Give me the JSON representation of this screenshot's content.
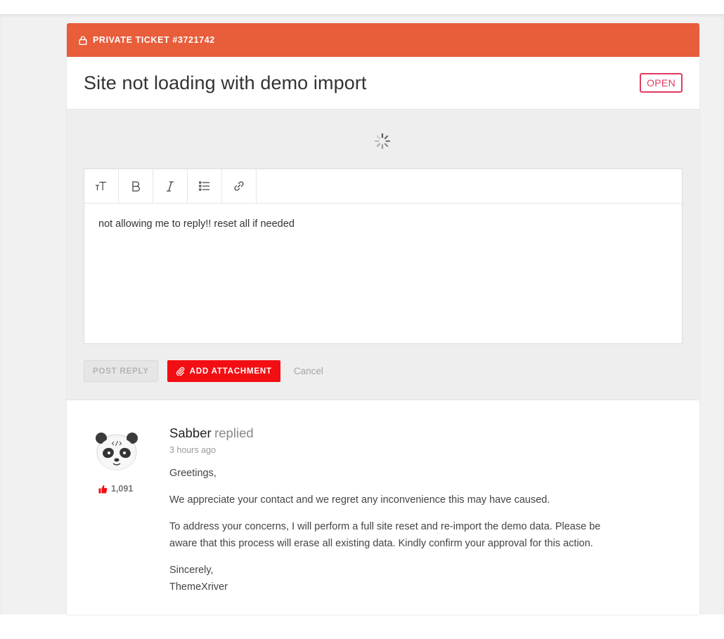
{
  "ticket": {
    "header_label": "PRIVATE TICKET #3721742",
    "title": "Site not loading with demo import",
    "status": "OPEN",
    "status_color": "#e23a62",
    "header_color": "#e85d3a"
  },
  "editor": {
    "toolbar": [
      {
        "name": "text-size-icon"
      },
      {
        "name": "bold-icon"
      },
      {
        "name": "italic-icon"
      },
      {
        "name": "list-icon"
      },
      {
        "name": "link-icon"
      }
    ],
    "content": "not allowing me to reply!!   reset all if needed"
  },
  "actions": {
    "post_reply": "POST REPLY",
    "add_attachment": "ADD ATTACHMENT",
    "cancel": "Cancel",
    "accent": "#f20e13"
  },
  "reply": {
    "author": "Sabber",
    "verb": "replied",
    "time": "3 hours ago",
    "likes": "1,091",
    "paragraphs": [
      "Greetings,",
      "We appreciate your contact and we regret any inconvenience this may have caused.",
      "To address your concerns, I will perform a full site reset and re-import the demo data. Please be aware that this process will erase all existing data. Kindly confirm your approval for this action.",
      "Sincerely,",
      "ThemeXriver"
    ]
  }
}
